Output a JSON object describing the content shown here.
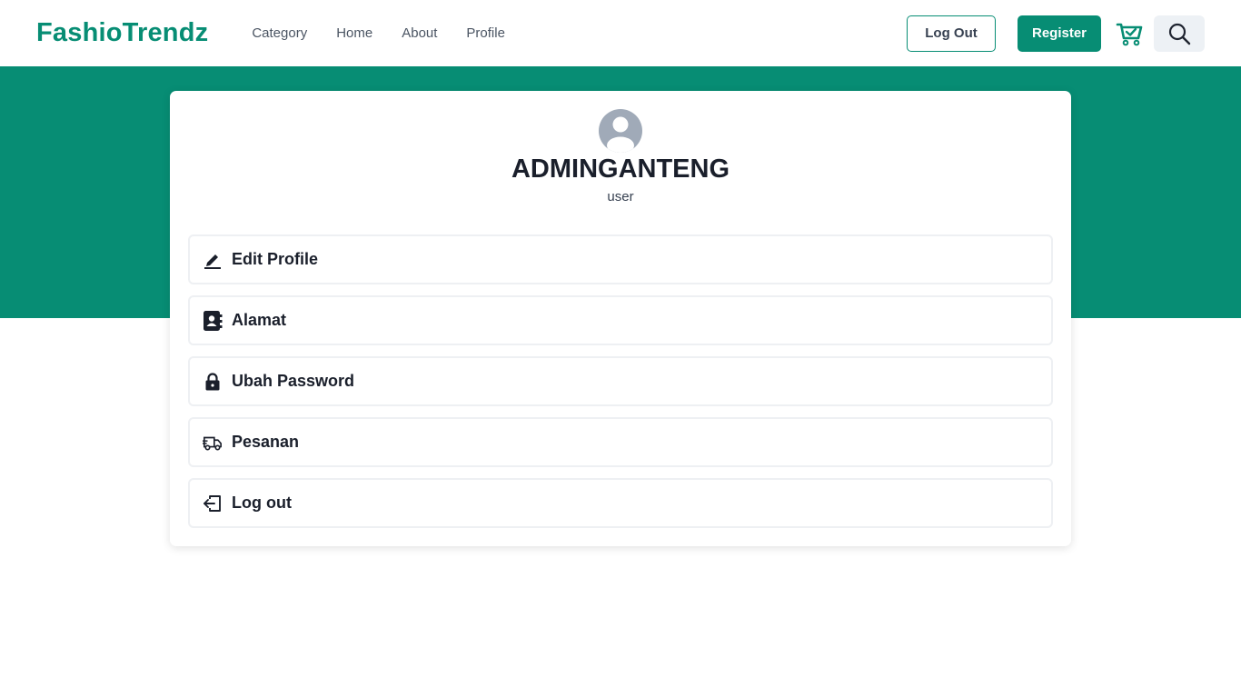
{
  "header": {
    "brand": "FashioTrendz",
    "nav": [
      {
        "label": "Category"
      },
      {
        "label": "Home"
      },
      {
        "label": "About"
      },
      {
        "label": "Profile"
      }
    ],
    "logout_label": "Log Out",
    "register_label": "Register",
    "cart_icon": "cart-check-icon",
    "search_icon": "search-icon"
  },
  "profile": {
    "username": "ADMINGANTENG",
    "role": "user",
    "avatar_icon": "user-avatar-icon"
  },
  "menu": [
    {
      "label": "Edit Profile",
      "icon": "pencil-icon"
    },
    {
      "label": "Alamat",
      "icon": "address-book-icon"
    },
    {
      "label": "Ubah Password",
      "icon": "lock-icon"
    },
    {
      "label": "Pesanan",
      "icon": "truck-icon"
    },
    {
      "label": "Log out",
      "icon": "logout-icon"
    }
  ],
  "colors": {
    "brand": "#078d74",
    "hero_background": "#078d74",
    "search_button_bg": "#edf1f5",
    "avatar": "#a0aab8"
  }
}
